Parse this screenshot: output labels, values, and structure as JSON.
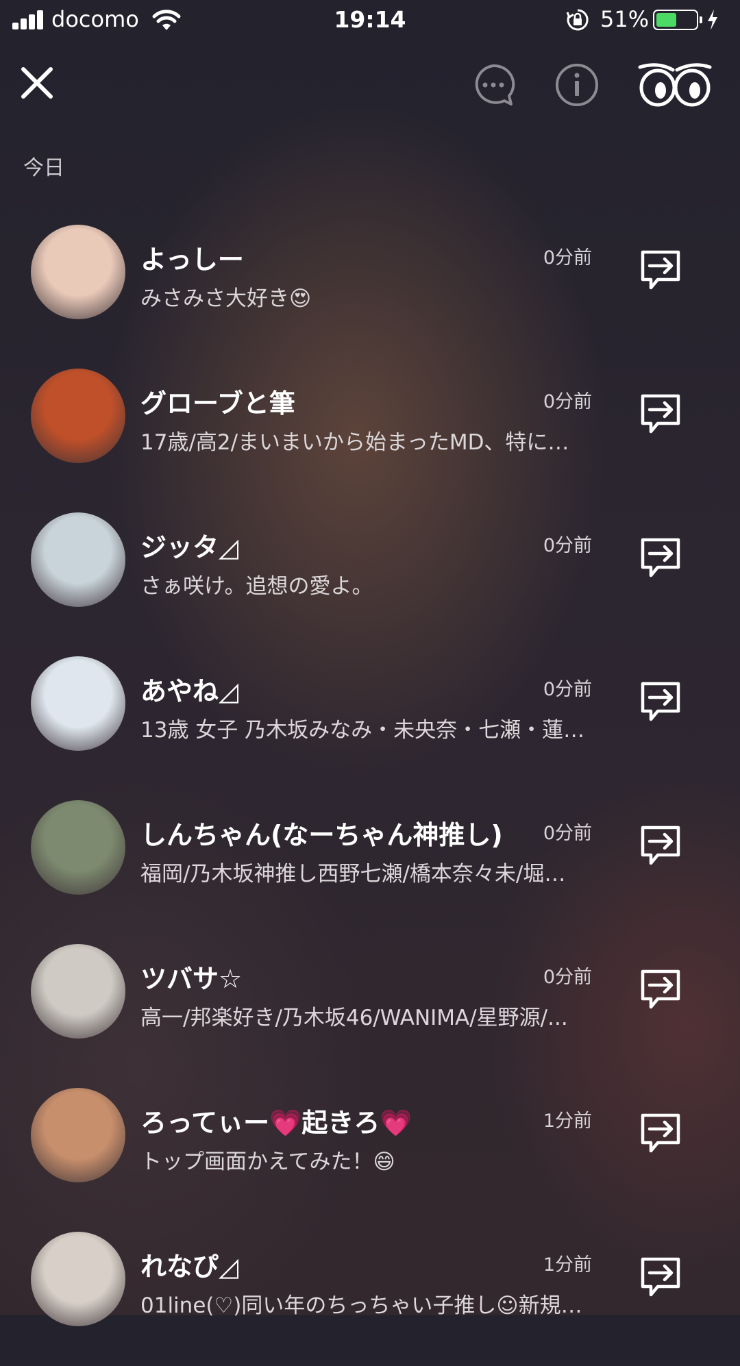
{
  "status_bar": {
    "carrier": "docomo",
    "time": "19:14",
    "battery_percent": "51%",
    "battery_level": 0.51,
    "icons": [
      "signal-icon",
      "wifi-icon",
      "rotation-lock-icon",
      "battery-icon",
      "charging-bolt-icon"
    ]
  },
  "nav": {
    "icons": [
      "close-icon",
      "chat-bubble-icon",
      "info-icon",
      "eyes-icon"
    ]
  },
  "section_label": "今日",
  "friends": [
    {
      "name": "よっしー",
      "status": "みさみさ大好き😍",
      "time": "0分前",
      "avatar_color": "#e9c9b8"
    },
    {
      "name": "グローブと筆",
      "status": "17歳/高2/まいまいから始まったMD、特に…",
      "time": "0分前",
      "avatar_color": "#c0502a"
    },
    {
      "name": "ジッタ◿",
      "status": "さぁ咲け。追想の愛よ。",
      "time": "0分前",
      "avatar_color": "#c9d3da"
    },
    {
      "name": "あやね◿",
      "status": "13歳 女子 乃木坂みなみ・未央奈・七瀬・蓮…",
      "time": "0分前",
      "avatar_color": "#dfe6ee"
    },
    {
      "name": "しんちゃん(なーちゃん神推し)",
      "status": "福岡/乃木坂神推し西野七瀬/橋本奈々未/堀…",
      "time": "0分前",
      "avatar_color": "#7d8a6f"
    },
    {
      "name": "ツバサ☆",
      "status": "高一/邦楽好き/乃木坂46/WANIMA/星野源/...",
      "time": "0分前",
      "avatar_color": "#cfcbc4"
    },
    {
      "name": "ろってぃー💗起きろ💗",
      "status": "トップ画面かえてみた！😄",
      "time": "1分前",
      "avatar_color": "#c88f6c"
    },
    {
      "name": "れなぴ◿",
      "status": "01line(♡)同い年のちっちゃい子推し☺新規…",
      "time": "1分前",
      "avatar_color": "#d8d0c8"
    }
  ]
}
